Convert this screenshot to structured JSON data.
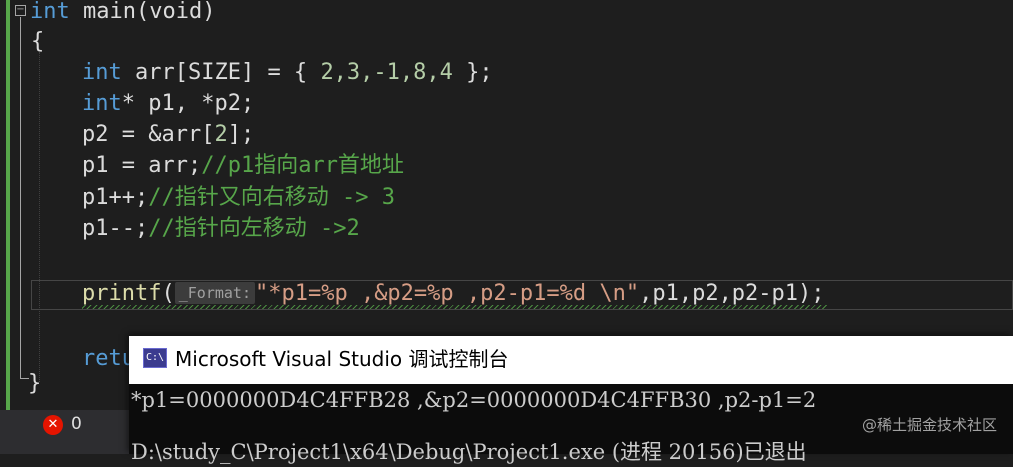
{
  "editor": {
    "lines": {
      "main_sig": {
        "type": "int",
        "name": " main(void)"
      },
      "open_brace": "{",
      "arr_decl": {
        "type": "int",
        "rest_a": " arr[SIZE] = { ",
        "values": "2,3,-1,8,4",
        "rest_b": " };"
      },
      "ptr_decl": {
        "type": "int",
        "rest": "* p1, *p2;"
      },
      "p2_assign": {
        "code_a": "p2 = &arr[",
        "index": "2",
        "code_b": "];"
      },
      "p1_assign": {
        "code": "p1 = arr;",
        "comment": "//p1指向arr首地址"
      },
      "p1_inc": {
        "code": "p1++;",
        "comment": "//指针又向右移动 -> 3"
      },
      "p1_dec": {
        "code": "p1--;",
        "comment": "//指针向左移动 ->2"
      },
      "printf": {
        "fn": "printf",
        "open": "(",
        "hint": "_Format:",
        "format": "\"*p1=%p ,&p2=%p ,p2-p1=%d \\n\"",
        "args": ",p1,p2,p2-p1",
        "close": ");"
      },
      "return_partial": "retu",
      "close_brace": "}"
    }
  },
  "status_bar": {
    "error_icon": "error-circle-icon",
    "error_count": "0"
  },
  "console": {
    "title": "Microsoft Visual Studio 调试控制台",
    "icon": "console-app-icon",
    "icon_text": "C:\\",
    "output_line1": "*p1=0000000D4C4FFB28 ,&p2=0000000D4C4FFB30 ,p2-p1=2",
    "output_line2": "D:\\study_C\\Project1\\x64\\Debug\\Project1.exe (进程 20156)已退出"
  },
  "watermark": "@稀土掘金技术社区",
  "colors": {
    "background": "#1e1e1e",
    "keyword": "#569cd6",
    "comment": "#57a64a",
    "string": "#d69d85",
    "function": "#dcdcaa",
    "number": "#b5cea8",
    "error": "#e51400"
  }
}
